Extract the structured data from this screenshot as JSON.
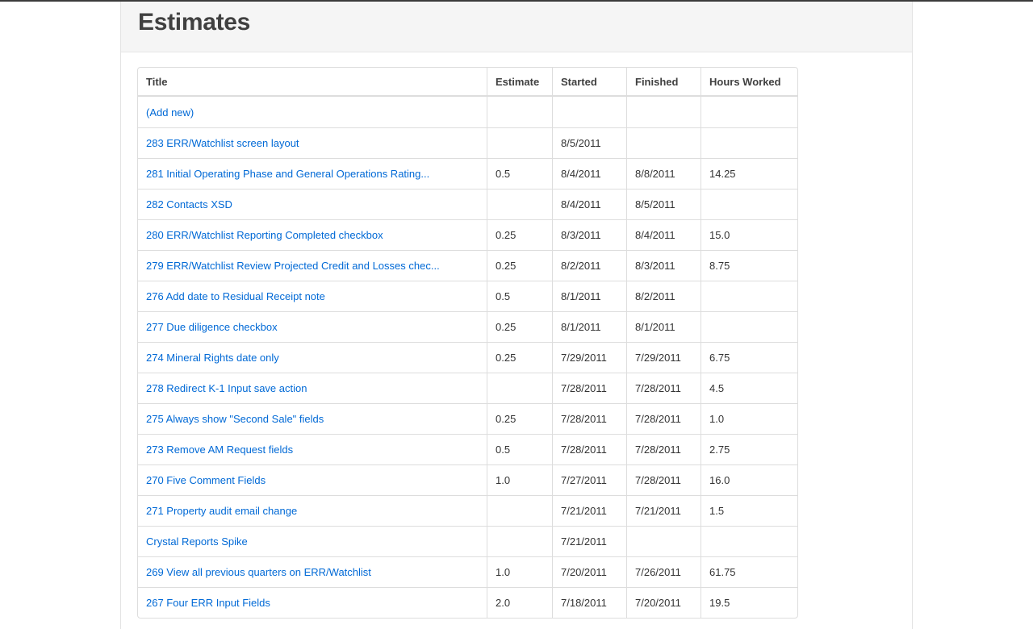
{
  "page": {
    "title": "Estimates"
  },
  "table": {
    "headers": {
      "title": "Title",
      "estimate": "Estimate",
      "started": "Started",
      "finished": "Finished",
      "hours": "Hours Worked"
    },
    "rows": [
      {
        "title": "(Add new)",
        "estimate": "",
        "started": "",
        "finished": "",
        "hours": ""
      },
      {
        "title": "283 ERR/Watchlist screen layout",
        "estimate": "",
        "started": "8/5/2011",
        "finished": "",
        "hours": ""
      },
      {
        "title": "281 Initial Operating Phase and General Operations Rating...",
        "estimate": "0.5",
        "started": "8/4/2011",
        "finished": "8/8/2011",
        "hours": "14.25"
      },
      {
        "title": "282 Contacts XSD",
        "estimate": "",
        "started": "8/4/2011",
        "finished": "8/5/2011",
        "hours": ""
      },
      {
        "title": "280 ERR/Watchlist Reporting Completed checkbox",
        "estimate": "0.25",
        "started": "8/3/2011",
        "finished": "8/4/2011",
        "hours": "15.0"
      },
      {
        "title": "279 ERR/Watchlist Review Projected Credit and Losses chec...",
        "estimate": "0.25",
        "started": "8/2/2011",
        "finished": "8/3/2011",
        "hours": "8.75"
      },
      {
        "title": "276 Add date to Residual Receipt note",
        "estimate": "0.5",
        "started": "8/1/2011",
        "finished": "8/2/2011",
        "hours": ""
      },
      {
        "title": "277 Due diligence checkbox",
        "estimate": "0.25",
        "started": "8/1/2011",
        "finished": "8/1/2011",
        "hours": ""
      },
      {
        "title": "274 Mineral Rights date only",
        "estimate": "0.25",
        "started": "7/29/2011",
        "finished": "7/29/2011",
        "hours": "6.75"
      },
      {
        "title": "278 Redirect K-1 Input save action",
        "estimate": "",
        "started": "7/28/2011",
        "finished": "7/28/2011",
        "hours": "4.5"
      },
      {
        "title": "275 Always show \"Second Sale\" fields",
        "estimate": "0.25",
        "started": "7/28/2011",
        "finished": "7/28/2011",
        "hours": "1.0"
      },
      {
        "title": "273 Remove AM Request fields",
        "estimate": "0.5",
        "started": "7/28/2011",
        "finished": "7/28/2011",
        "hours": "2.75"
      },
      {
        "title": "270 Five Comment Fields",
        "estimate": "1.0",
        "started": "7/27/2011",
        "finished": "7/28/2011",
        "hours": "16.0"
      },
      {
        "title": "271 Property audit email change",
        "estimate": "",
        "started": "7/21/2011",
        "finished": "7/21/2011",
        "hours": "1.5"
      },
      {
        "title": "Crystal Reports Spike",
        "estimate": "",
        "started": "7/21/2011",
        "finished": "",
        "hours": ""
      },
      {
        "title": "269 View all previous quarters on ERR/Watchlist",
        "estimate": "1.0",
        "started": "7/20/2011",
        "finished": "7/26/2011",
        "hours": "61.75"
      },
      {
        "title": "267 Four ERR Input Fields",
        "estimate": "2.0",
        "started": "7/18/2011",
        "finished": "7/20/2011",
        "hours": "19.5"
      }
    ]
  },
  "colors": {
    "link": "#0069d6",
    "header_bg": "#f5f5f5",
    "border": "#dddddd",
    "title_text": "#404040"
  }
}
